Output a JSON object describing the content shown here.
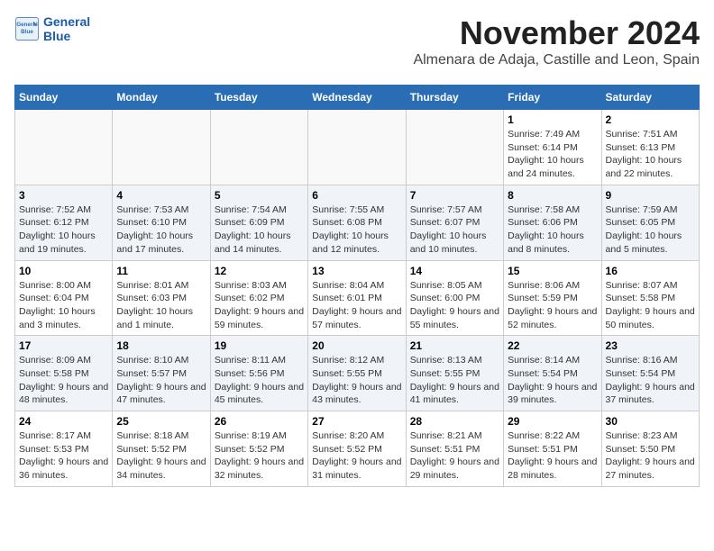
{
  "header": {
    "logo_line1": "General",
    "logo_line2": "Blue",
    "month_year": "November 2024",
    "location": "Almenara de Adaja, Castille and Leon, Spain"
  },
  "weekdays": [
    "Sunday",
    "Monday",
    "Tuesday",
    "Wednesday",
    "Thursday",
    "Friday",
    "Saturday"
  ],
  "weeks": [
    [
      {
        "day": "",
        "info": ""
      },
      {
        "day": "",
        "info": ""
      },
      {
        "day": "",
        "info": ""
      },
      {
        "day": "",
        "info": ""
      },
      {
        "day": "",
        "info": ""
      },
      {
        "day": "1",
        "info": "Sunrise: 7:49 AM\nSunset: 6:14 PM\nDaylight: 10 hours and 24 minutes."
      },
      {
        "day": "2",
        "info": "Sunrise: 7:51 AM\nSunset: 6:13 PM\nDaylight: 10 hours and 22 minutes."
      }
    ],
    [
      {
        "day": "3",
        "info": "Sunrise: 7:52 AM\nSunset: 6:12 PM\nDaylight: 10 hours and 19 minutes."
      },
      {
        "day": "4",
        "info": "Sunrise: 7:53 AM\nSunset: 6:10 PM\nDaylight: 10 hours and 17 minutes."
      },
      {
        "day": "5",
        "info": "Sunrise: 7:54 AM\nSunset: 6:09 PM\nDaylight: 10 hours and 14 minutes."
      },
      {
        "day": "6",
        "info": "Sunrise: 7:55 AM\nSunset: 6:08 PM\nDaylight: 10 hours and 12 minutes."
      },
      {
        "day": "7",
        "info": "Sunrise: 7:57 AM\nSunset: 6:07 PM\nDaylight: 10 hours and 10 minutes."
      },
      {
        "day": "8",
        "info": "Sunrise: 7:58 AM\nSunset: 6:06 PM\nDaylight: 10 hours and 8 minutes."
      },
      {
        "day": "9",
        "info": "Sunrise: 7:59 AM\nSunset: 6:05 PM\nDaylight: 10 hours and 5 minutes."
      }
    ],
    [
      {
        "day": "10",
        "info": "Sunrise: 8:00 AM\nSunset: 6:04 PM\nDaylight: 10 hours and 3 minutes."
      },
      {
        "day": "11",
        "info": "Sunrise: 8:01 AM\nSunset: 6:03 PM\nDaylight: 10 hours and 1 minute."
      },
      {
        "day": "12",
        "info": "Sunrise: 8:03 AM\nSunset: 6:02 PM\nDaylight: 9 hours and 59 minutes."
      },
      {
        "day": "13",
        "info": "Sunrise: 8:04 AM\nSunset: 6:01 PM\nDaylight: 9 hours and 57 minutes."
      },
      {
        "day": "14",
        "info": "Sunrise: 8:05 AM\nSunset: 6:00 PM\nDaylight: 9 hours and 55 minutes."
      },
      {
        "day": "15",
        "info": "Sunrise: 8:06 AM\nSunset: 5:59 PM\nDaylight: 9 hours and 52 minutes."
      },
      {
        "day": "16",
        "info": "Sunrise: 8:07 AM\nSunset: 5:58 PM\nDaylight: 9 hours and 50 minutes."
      }
    ],
    [
      {
        "day": "17",
        "info": "Sunrise: 8:09 AM\nSunset: 5:58 PM\nDaylight: 9 hours and 48 minutes."
      },
      {
        "day": "18",
        "info": "Sunrise: 8:10 AM\nSunset: 5:57 PM\nDaylight: 9 hours and 47 minutes."
      },
      {
        "day": "19",
        "info": "Sunrise: 8:11 AM\nSunset: 5:56 PM\nDaylight: 9 hours and 45 minutes."
      },
      {
        "day": "20",
        "info": "Sunrise: 8:12 AM\nSunset: 5:55 PM\nDaylight: 9 hours and 43 minutes."
      },
      {
        "day": "21",
        "info": "Sunrise: 8:13 AM\nSunset: 5:55 PM\nDaylight: 9 hours and 41 minutes."
      },
      {
        "day": "22",
        "info": "Sunrise: 8:14 AM\nSunset: 5:54 PM\nDaylight: 9 hours and 39 minutes."
      },
      {
        "day": "23",
        "info": "Sunrise: 8:16 AM\nSunset: 5:54 PM\nDaylight: 9 hours and 37 minutes."
      }
    ],
    [
      {
        "day": "24",
        "info": "Sunrise: 8:17 AM\nSunset: 5:53 PM\nDaylight: 9 hours and 36 minutes."
      },
      {
        "day": "25",
        "info": "Sunrise: 8:18 AM\nSunset: 5:52 PM\nDaylight: 9 hours and 34 minutes."
      },
      {
        "day": "26",
        "info": "Sunrise: 8:19 AM\nSunset: 5:52 PM\nDaylight: 9 hours and 32 minutes."
      },
      {
        "day": "27",
        "info": "Sunrise: 8:20 AM\nSunset: 5:52 PM\nDaylight: 9 hours and 31 minutes."
      },
      {
        "day": "28",
        "info": "Sunrise: 8:21 AM\nSunset: 5:51 PM\nDaylight: 9 hours and 29 minutes."
      },
      {
        "day": "29",
        "info": "Sunrise: 8:22 AM\nSunset: 5:51 PM\nDaylight: 9 hours and 28 minutes."
      },
      {
        "day": "30",
        "info": "Sunrise: 8:23 AM\nSunset: 5:50 PM\nDaylight: 9 hours and 27 minutes."
      }
    ]
  ]
}
